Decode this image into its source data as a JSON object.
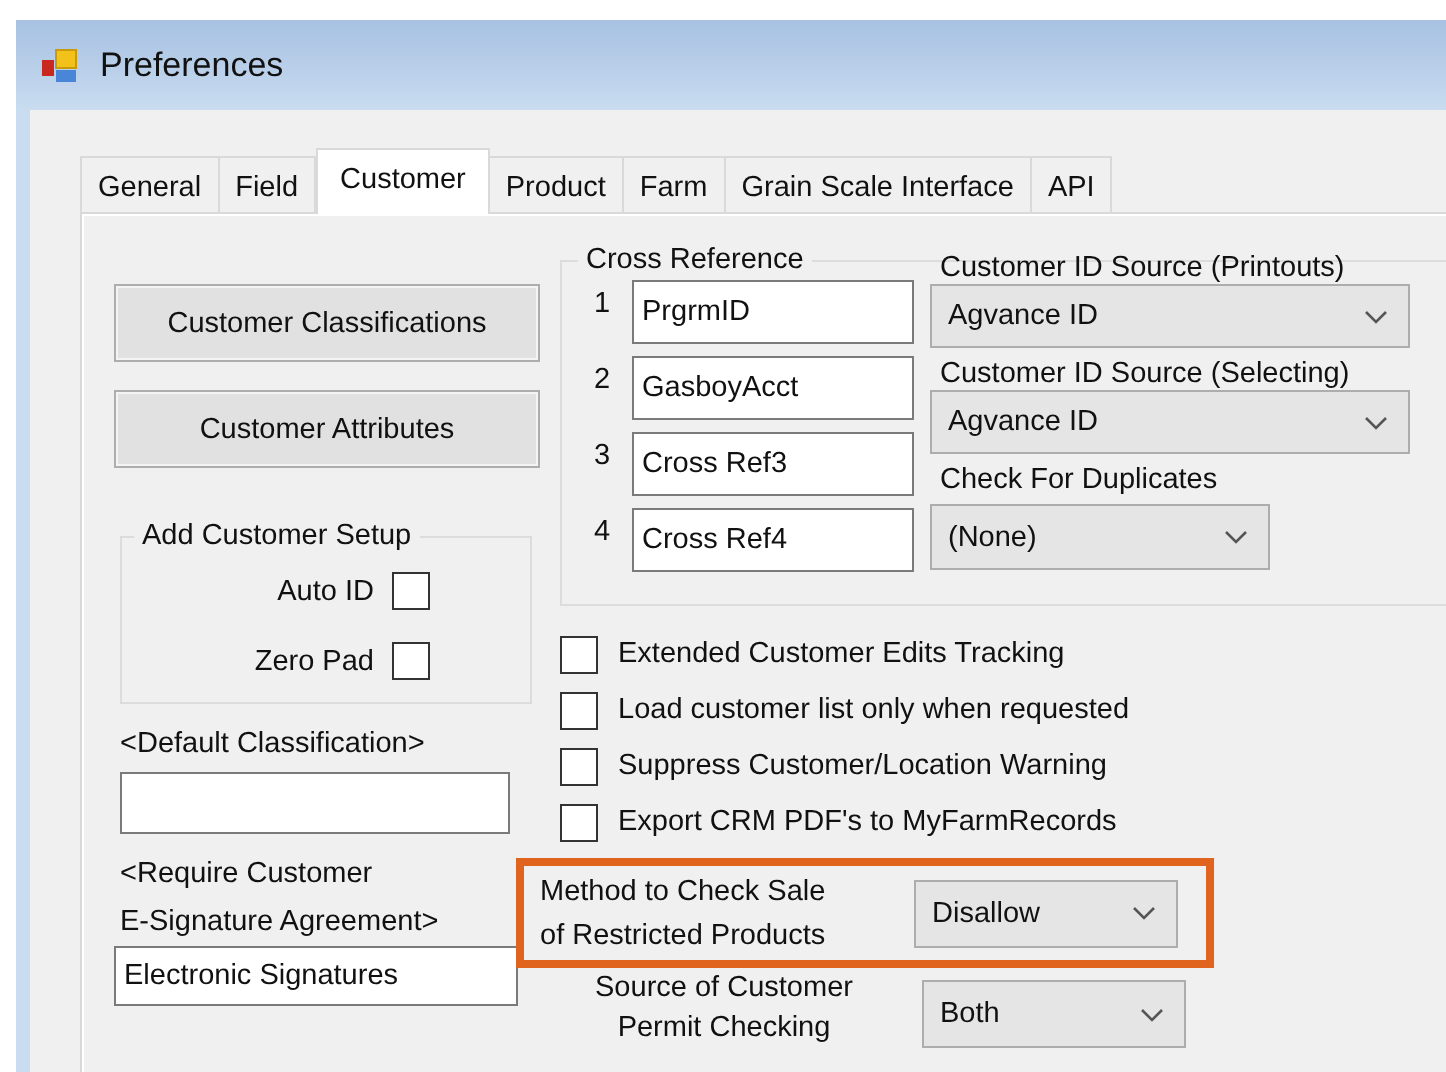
{
  "window": {
    "title": "Preferences"
  },
  "tabs": [
    {
      "label": "General",
      "selected": false
    },
    {
      "label": "Field",
      "selected": false
    },
    {
      "label": "Customer",
      "selected": true
    },
    {
      "label": "Product",
      "selected": false
    },
    {
      "label": "Farm",
      "selected": false
    },
    {
      "label": "Grain Scale Interface",
      "selected": false
    },
    {
      "label": "API",
      "selected": false
    }
  ],
  "buttons": [
    "Customer Classifications",
    "Customer Attributes"
  ],
  "add_customer_setup": {
    "title": "Add Customer Setup",
    "options": [
      {
        "label": "Auto ID",
        "checked": false
      },
      {
        "label": "Zero Pad",
        "checked": false
      }
    ]
  },
  "default_classification": {
    "label": "<Default Classification>"
  },
  "e_signature": {
    "label_lines": [
      "<Require Customer",
      "E-Signature Agreement>"
    ],
    "value": "Electronic Signatures"
  },
  "cross_reference": {
    "title": "Cross Reference",
    "entries": [
      {
        "number": "1",
        "value": "PrgrmID"
      },
      {
        "number": "2",
        "value": "GasboyAcct"
      },
      {
        "number": "3",
        "value": "Cross Ref3"
      },
      {
        "number": "4",
        "value": "Cross Ref4"
      }
    ]
  },
  "id_settings": [
    {
      "label": "Customer ID Source (Printouts)",
      "value": "Agvance ID",
      "wide": true
    },
    {
      "label": "Customer ID Source (Selecting)",
      "value": "Agvance ID",
      "wide": true
    },
    {
      "label": "Check For Duplicates",
      "value": "(None)",
      "wide": false
    }
  ],
  "options": [
    {
      "label": "Extended Customer Edits Tracking",
      "checked": false
    },
    {
      "label": "Load customer list only when requested",
      "checked": false
    },
    {
      "label": "Suppress Customer/Location Warning",
      "checked": false
    },
    {
      "label": "Export CRM PDF's to MyFarmRecords",
      "checked": false
    }
  ],
  "select_settings": [
    {
      "label_lines": [
        "Method to Check Sale",
        "of Restricted Products"
      ],
      "value": "Disallow",
      "highlighted": true
    },
    {
      "label_lines": [
        "Source of Customer",
        "Permit Checking"
      ],
      "value": "Both",
      "highlighted": false
    }
  ]
}
